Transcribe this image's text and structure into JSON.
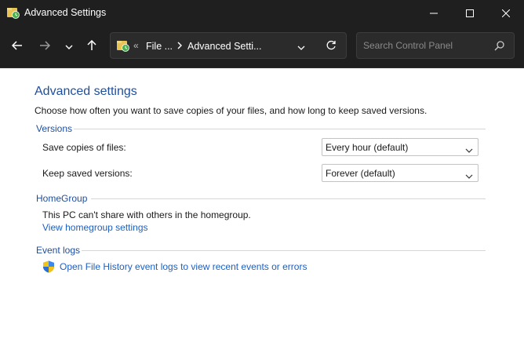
{
  "window": {
    "title": "Advanced Settings"
  },
  "titlebar": {
    "icon": "file-history-icon",
    "buttons": [
      "minimize-icon",
      "maximize-icon",
      "close-icon"
    ]
  },
  "nav": {
    "back_icon": "arrow-left-icon",
    "forward_icon": "arrow-right-icon",
    "recent_icon": "chevron-down-icon",
    "up_icon": "arrow-up-icon",
    "address": {
      "overflow_chevron": "«",
      "crumbs": [
        "File ...",
        "Advanced Setti..."
      ]
    },
    "search": {
      "placeholder": "Search Control Panel",
      "value": ""
    }
  },
  "page": {
    "title": "Advanced settings",
    "description": "Choose how often you want to save copies of your files, and how long to keep saved versions."
  },
  "versions": {
    "heading": "Versions",
    "save_copies_label": "Save copies of files:",
    "save_copies_value": "Every hour (default)",
    "keep_versions_label": "Keep saved versions:",
    "keep_versions_value": "Forever (default)"
  },
  "homegroup": {
    "heading": "HomeGroup",
    "status": "This PC can't share with others in the homegroup.",
    "link": "View homegroup settings"
  },
  "event_logs": {
    "heading": "Event logs",
    "link": "Open File History event logs to view recent events or errors",
    "icon": "uac-shield-icon"
  },
  "colors": {
    "titlebar_bg": "#1f1f1f",
    "heading_blue": "#1f4e9c",
    "link_blue": "#1f5fbf"
  }
}
